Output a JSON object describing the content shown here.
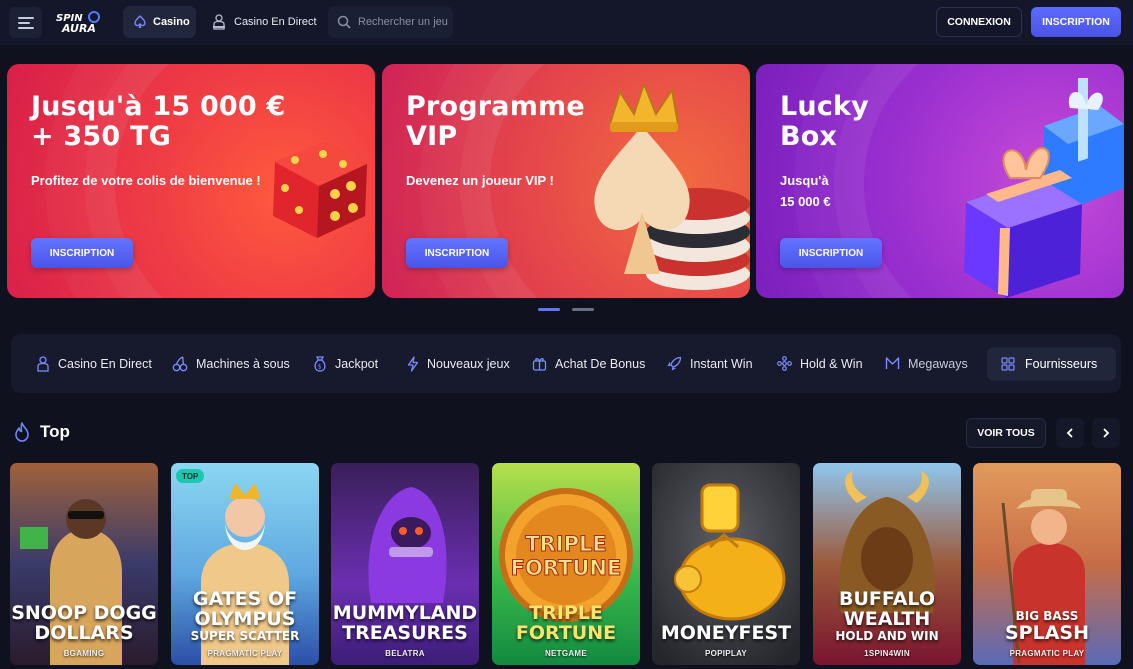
{
  "header": {
    "logo_text": "SPIN AURA",
    "nav_casino": "Casino",
    "nav_live": "Casino En Direct",
    "search_placeholder": "Rechercher un jeu",
    "login": "CONNEXION",
    "register": "INSCRIPTION"
  },
  "banners": [
    {
      "title": "Jusqu'à 15 000 €\n+ 350 TG",
      "subtitle": "Profitez de votre colis de bienvenue !",
      "button": "INSCRIPTION",
      "art": "red-dice"
    },
    {
      "title": "Programme\nVIP",
      "subtitle": "Devenez un joueur VIP !",
      "button": "INSCRIPTION",
      "art": "spade-crown-chips"
    },
    {
      "title": "Lucky\nBox",
      "subtitle": "Jusqu'à\n15 000 €",
      "button": "INSCRIPTION",
      "art": "gift-boxes"
    }
  ],
  "carousel": {
    "pages": 2,
    "active": 0
  },
  "categories": [
    {
      "label": "Casino En Direct",
      "icon": "dealer-icon"
    },
    {
      "label": "Machines à sous",
      "icon": "cherries-icon"
    },
    {
      "label": "Jackpot",
      "icon": "money-bag-icon"
    },
    {
      "label": "Nouveaux jeux",
      "icon": "lightning-icon"
    },
    {
      "label": "Achat De Bonus",
      "icon": "gift-icon"
    },
    {
      "label": "Instant Win",
      "icon": "rocket-icon"
    },
    {
      "label": "Hold & Win",
      "icon": "grid-dots-icon"
    },
    {
      "label": "Megaways",
      "icon": "megaways-icon"
    },
    {
      "label": "Fournisseurs",
      "icon": "grid-icon"
    }
  ],
  "top": {
    "title": "Top",
    "see_all": "VOIR TOUS"
  },
  "games": [
    {
      "name": "SNOOP DOGG\nDOLLARS",
      "extra": "",
      "provider": "BGAMING",
      "badge": ""
    },
    {
      "name": "GATES OF\nOLYMPUS",
      "extra": "SUPER SCATTER",
      "provider": "PRAGMATIC PLAY",
      "badge": "TOP"
    },
    {
      "name": "MUMMYLAND\nTREASURES",
      "extra": "",
      "provider": "BELATRA",
      "badge": ""
    },
    {
      "name": "TRIPLE\nFORTUNE",
      "extra": "",
      "provider": "NETGAME",
      "badge": ""
    },
    {
      "name": "MONEYFEST",
      "extra": "",
      "provider": "POPIPLAY",
      "badge": ""
    },
    {
      "name": "BUFFALO\nWEALTH",
      "extra": "HOLD AND WIN",
      "provider": "1SPIN4WIN",
      "badge": ""
    },
    {
      "name": "BIG BASS\nSPLASH",
      "extra": "",
      "provider": "PRAGMATIC PLAY",
      "badge": ""
    }
  ],
  "colors": {
    "background": "#0f111f",
    "header": "#14172a",
    "accent": "#5b6bff",
    "badge": "#1cc7b0"
  }
}
